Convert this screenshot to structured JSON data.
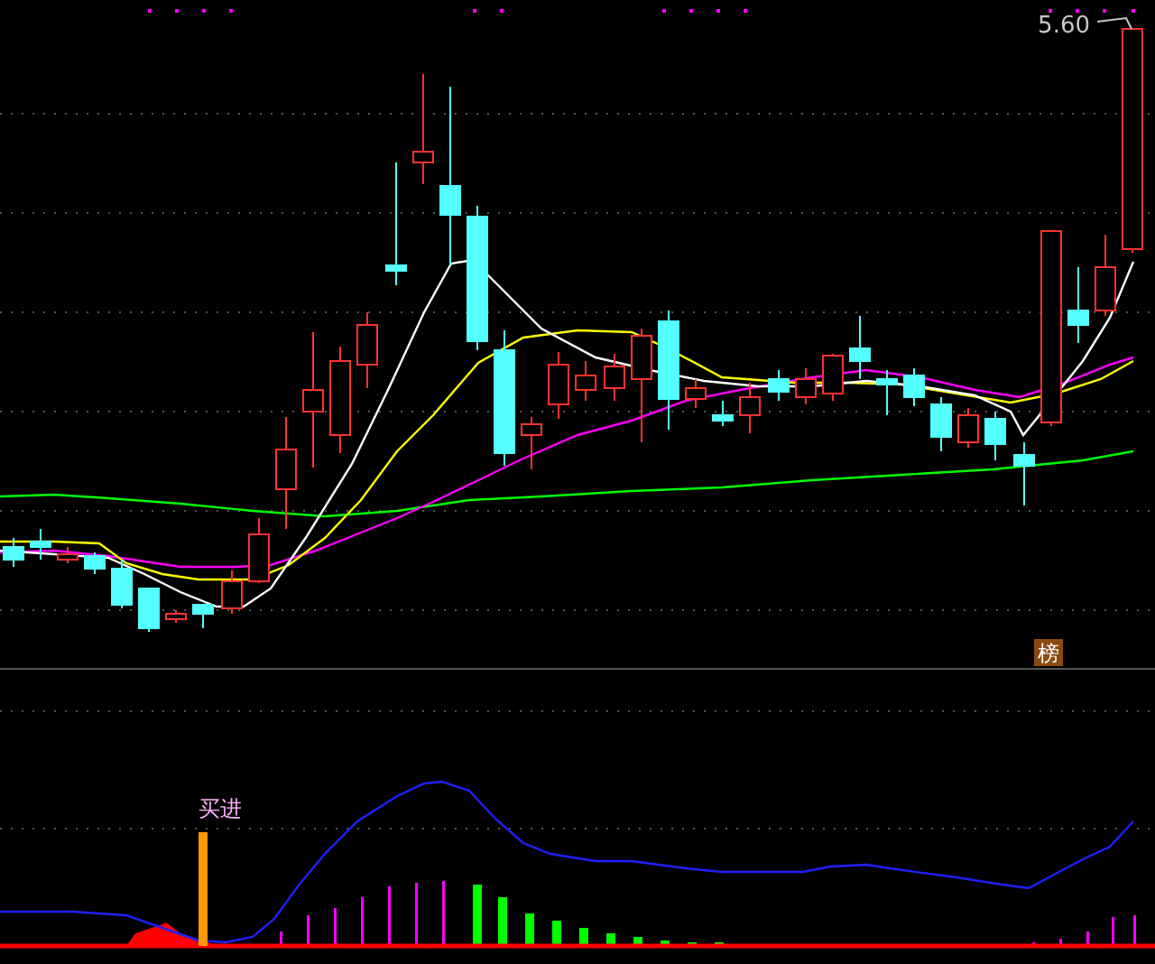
{
  "price_panel": {
    "high_label": "5.60",
    "badge": "榜"
  },
  "indicator_panel": {
    "signal_label": "买进"
  }
}
